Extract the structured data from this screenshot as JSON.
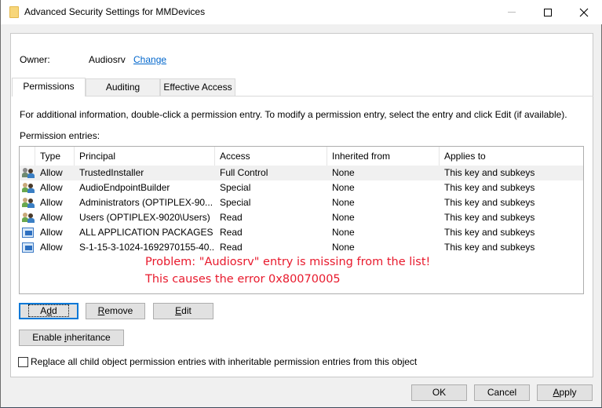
{
  "window": {
    "title": "Advanced Security Settings for MMDevices",
    "controls": [
      "minimize",
      "maximize",
      "close"
    ],
    "title_icon": "folder-icon"
  },
  "owner": {
    "label": "Owner:",
    "value": "Audiosrv",
    "change_link": "Change"
  },
  "tabs": [
    {
      "label": "Permissions",
      "active": true
    },
    {
      "label": "Auditing",
      "active": false
    },
    {
      "label": "Effective Access",
      "active": false
    }
  ],
  "info_text": "For additional information, double-click a permission entry. To modify a permission entry, select the entry and click Edit (if available).",
  "entries_label": "Permission entries:",
  "columns": [
    "Type",
    "Principal",
    "Access",
    "Inherited from",
    "Applies to"
  ],
  "entries": [
    {
      "icon": "user-group-icon",
      "type": "Allow",
      "principal": "TrustedInstaller",
      "access": "Full Control",
      "inherited": "None",
      "applies": "This key and subkeys",
      "selected": true
    },
    {
      "icon": "user-group-icon",
      "type": "Allow",
      "principal": "AudioEndpointBuilder",
      "access": "Special",
      "inherited": "None",
      "applies": "This key and subkeys"
    },
    {
      "icon": "user-group-icon",
      "type": "Allow",
      "principal": "Administrators (OPTIPLEX-90...",
      "access": "Special",
      "inherited": "None",
      "applies": "This key and subkeys"
    },
    {
      "icon": "user-group-icon",
      "type": "Allow",
      "principal": "Users (OPTIPLEX-9020\\Users)",
      "access": "Read",
      "inherited": "None",
      "applies": "This key and subkeys"
    },
    {
      "icon": "app-package-icon",
      "type": "Allow",
      "principal": "ALL APPLICATION PACKAGES",
      "access": "Read",
      "inherited": "None",
      "applies": "This key and subkeys"
    },
    {
      "icon": "app-package-icon",
      "type": "Allow",
      "principal": "S-1-15-3-1024-1692970155-40...",
      "access": "Read",
      "inherited": "None",
      "applies": "This key and subkeys"
    }
  ],
  "annotation": {
    "line1": "Problem:  \"Audiosrv\" entry is missing from the list!",
    "line2": "This causes the error 0x80070005",
    "color": "#e8192c"
  },
  "buttons": {
    "add": {
      "pre": "A",
      "u": "d",
      "post": "d"
    },
    "remove": {
      "pre": "",
      "u": "R",
      "post": "emove"
    },
    "edit": {
      "pre": "",
      "u": "E",
      "post": "dit"
    },
    "enable_inheritance": {
      "pre": "Enable ",
      "u": "i",
      "post": "nheritance"
    },
    "ok": "OK",
    "cancel": "Cancel",
    "apply": {
      "pre": "",
      "u": "A",
      "post": "pply"
    }
  },
  "replace_checkbox": {
    "checked": false,
    "label_pre": "Re",
    "label_u": "p",
    "label_post": "lace all child object permission entries with inheritable permission entries from this object"
  }
}
